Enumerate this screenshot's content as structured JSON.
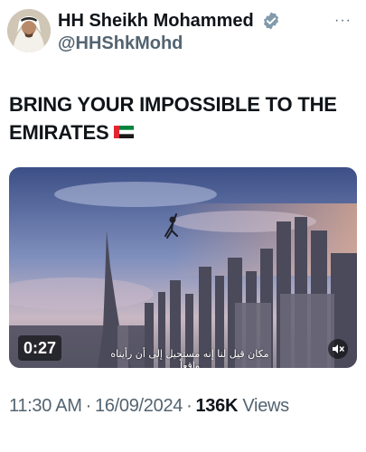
{
  "author": {
    "display_name": "HH Sheikh Mohammed",
    "handle": "@HHShkMohd",
    "verified": true,
    "avatar_icon": "profile-photo"
  },
  "more_label": "···",
  "tweet": {
    "text": "BRING YOUR IMPOSSIBLE TO THE EMIRATES",
    "emoji": "uae-flag"
  },
  "video": {
    "duration": "0:27",
    "subtitle": "مكان قيل لنا إنه مستحيل إلى أن رأيناه واقعاً",
    "muted_icon": "speaker-muted-icon"
  },
  "meta": {
    "time": "11:30 AM",
    "date": "16/09/2024",
    "separator": "·",
    "views_count": "136K",
    "views_label": "Views"
  },
  "colors": {
    "text_primary": "#0f1419",
    "text_secondary": "#536471",
    "verified_blue": "#829aab"
  }
}
